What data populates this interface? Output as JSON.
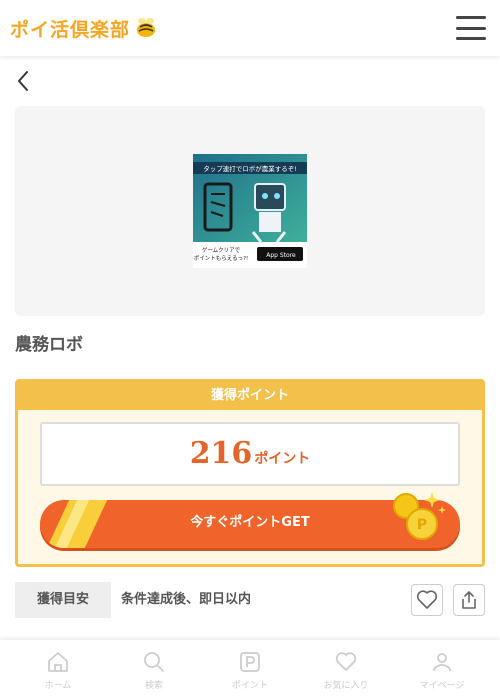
{
  "header": {
    "logo_text": "ポイ活倶楽部",
    "logo_icon": "bee-icon",
    "menu_icon": "hamburger-menu-icon"
  },
  "nav": {
    "back_icon": "chevron-left-icon"
  },
  "app": {
    "thumb_top": "タップ連打でロボが農業するぞ!",
    "thumb_bottom": "ゲームクリアでポイントもらえるっ?!",
    "store_badge": "App Store",
    "title": "農務ロボ"
  },
  "points": {
    "header": "獲得ポイント",
    "value": "216",
    "unit": "ポイント",
    "get_button": "今すぐポイントGET"
  },
  "guide": {
    "label": "獲得目安",
    "text": "条件達成後、即日以内",
    "fav_icon": "heart-icon",
    "share_icon": "share-icon"
  },
  "bottom_nav": {
    "items": [
      {
        "label": "ホーム",
        "icon": "home-icon"
      },
      {
        "label": "検索",
        "icon": "search-icon"
      },
      {
        "label": "ポイント",
        "icon": "point-icon"
      },
      {
        "label": "お気に入り",
        "icon": "heart-icon"
      },
      {
        "label": "マイページ",
        "icon": "user-icon"
      }
    ]
  },
  "colors": {
    "brand_yellow": "#f3c04a",
    "accent_orange": "#f0642b",
    "points_text": "#e5642b"
  }
}
